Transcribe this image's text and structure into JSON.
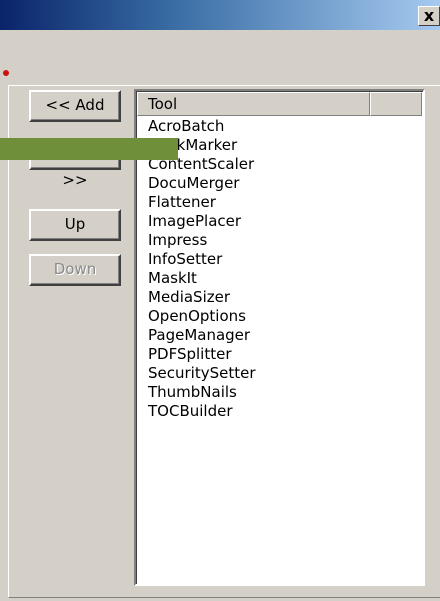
{
  "window": {
    "close_glyph": "x"
  },
  "buttons": {
    "add_label": "<< Add",
    "remove_label": "Remove >>",
    "up_label": "Up",
    "down_label": "Down"
  },
  "list": {
    "column_header": "Tool",
    "items": [
      "AcroBatch",
      "BookMarker",
      "ContentScaler",
      "DocuMerger",
      "Flattener",
      "ImagePlacer",
      "Impress",
      "InfoSetter",
      "MaskIt",
      "MediaSizer",
      "OpenOptions",
      "PageManager",
      "PDFSplitter",
      "SecuritySetter",
      "ThumbNails",
      "TOCBuilder"
    ]
  },
  "colors": {
    "annotation_bar": "#6f8f3a",
    "annotation_dot": "#cc1111",
    "title_bar": "#0a246a"
  }
}
